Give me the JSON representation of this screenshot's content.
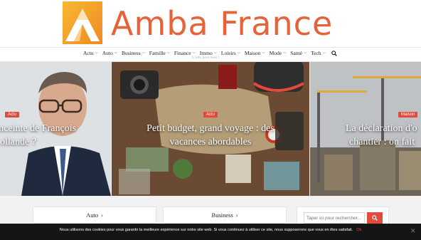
{
  "brand": {
    "name": "Amba France",
    "tagline": "L'info pour tous !",
    "primary_color": "#e6633a",
    "accent_color": "#e24a3b"
  },
  "nav": {
    "items": [
      {
        "label": "Actu"
      },
      {
        "label": "Auto"
      },
      {
        "label": "Business"
      },
      {
        "label": "Famille"
      },
      {
        "label": "Finance"
      },
      {
        "label": "Immo"
      },
      {
        "label": "Loisirs"
      },
      {
        "label": "Maison"
      },
      {
        "label": "Mode"
      },
      {
        "label": "Santé"
      },
      {
        "label": "Tech"
      }
    ],
    "search_icon": "search-icon"
  },
  "slides": [
    {
      "category": "Actu",
      "title_line1": "enceinte de François",
      "title_line2": "ollande ?"
    },
    {
      "category": "Actu",
      "title_line1": "Petit budget, grand voyage : des",
      "title_line2": "vacances abordables"
    },
    {
      "category": "Maison",
      "title_line1": "La déclaration d'o",
      "title_line2": "chantier : on fait"
    }
  ],
  "cards": [
    {
      "label": "Auto"
    },
    {
      "label": "Business"
    }
  ],
  "search": {
    "placeholder": "Taper ici pour rechercher...",
    "button_icon": "search-icon"
  },
  "cookie": {
    "text": "Nous utilisons des cookies pour vous garantir la meilleure expérience sur notre site web. Si vous continuez à utiliser ce site, nous supposerons que vous en êtes satisfait.",
    "ok_label": "Ok",
    "close_icon": "close-icon"
  }
}
